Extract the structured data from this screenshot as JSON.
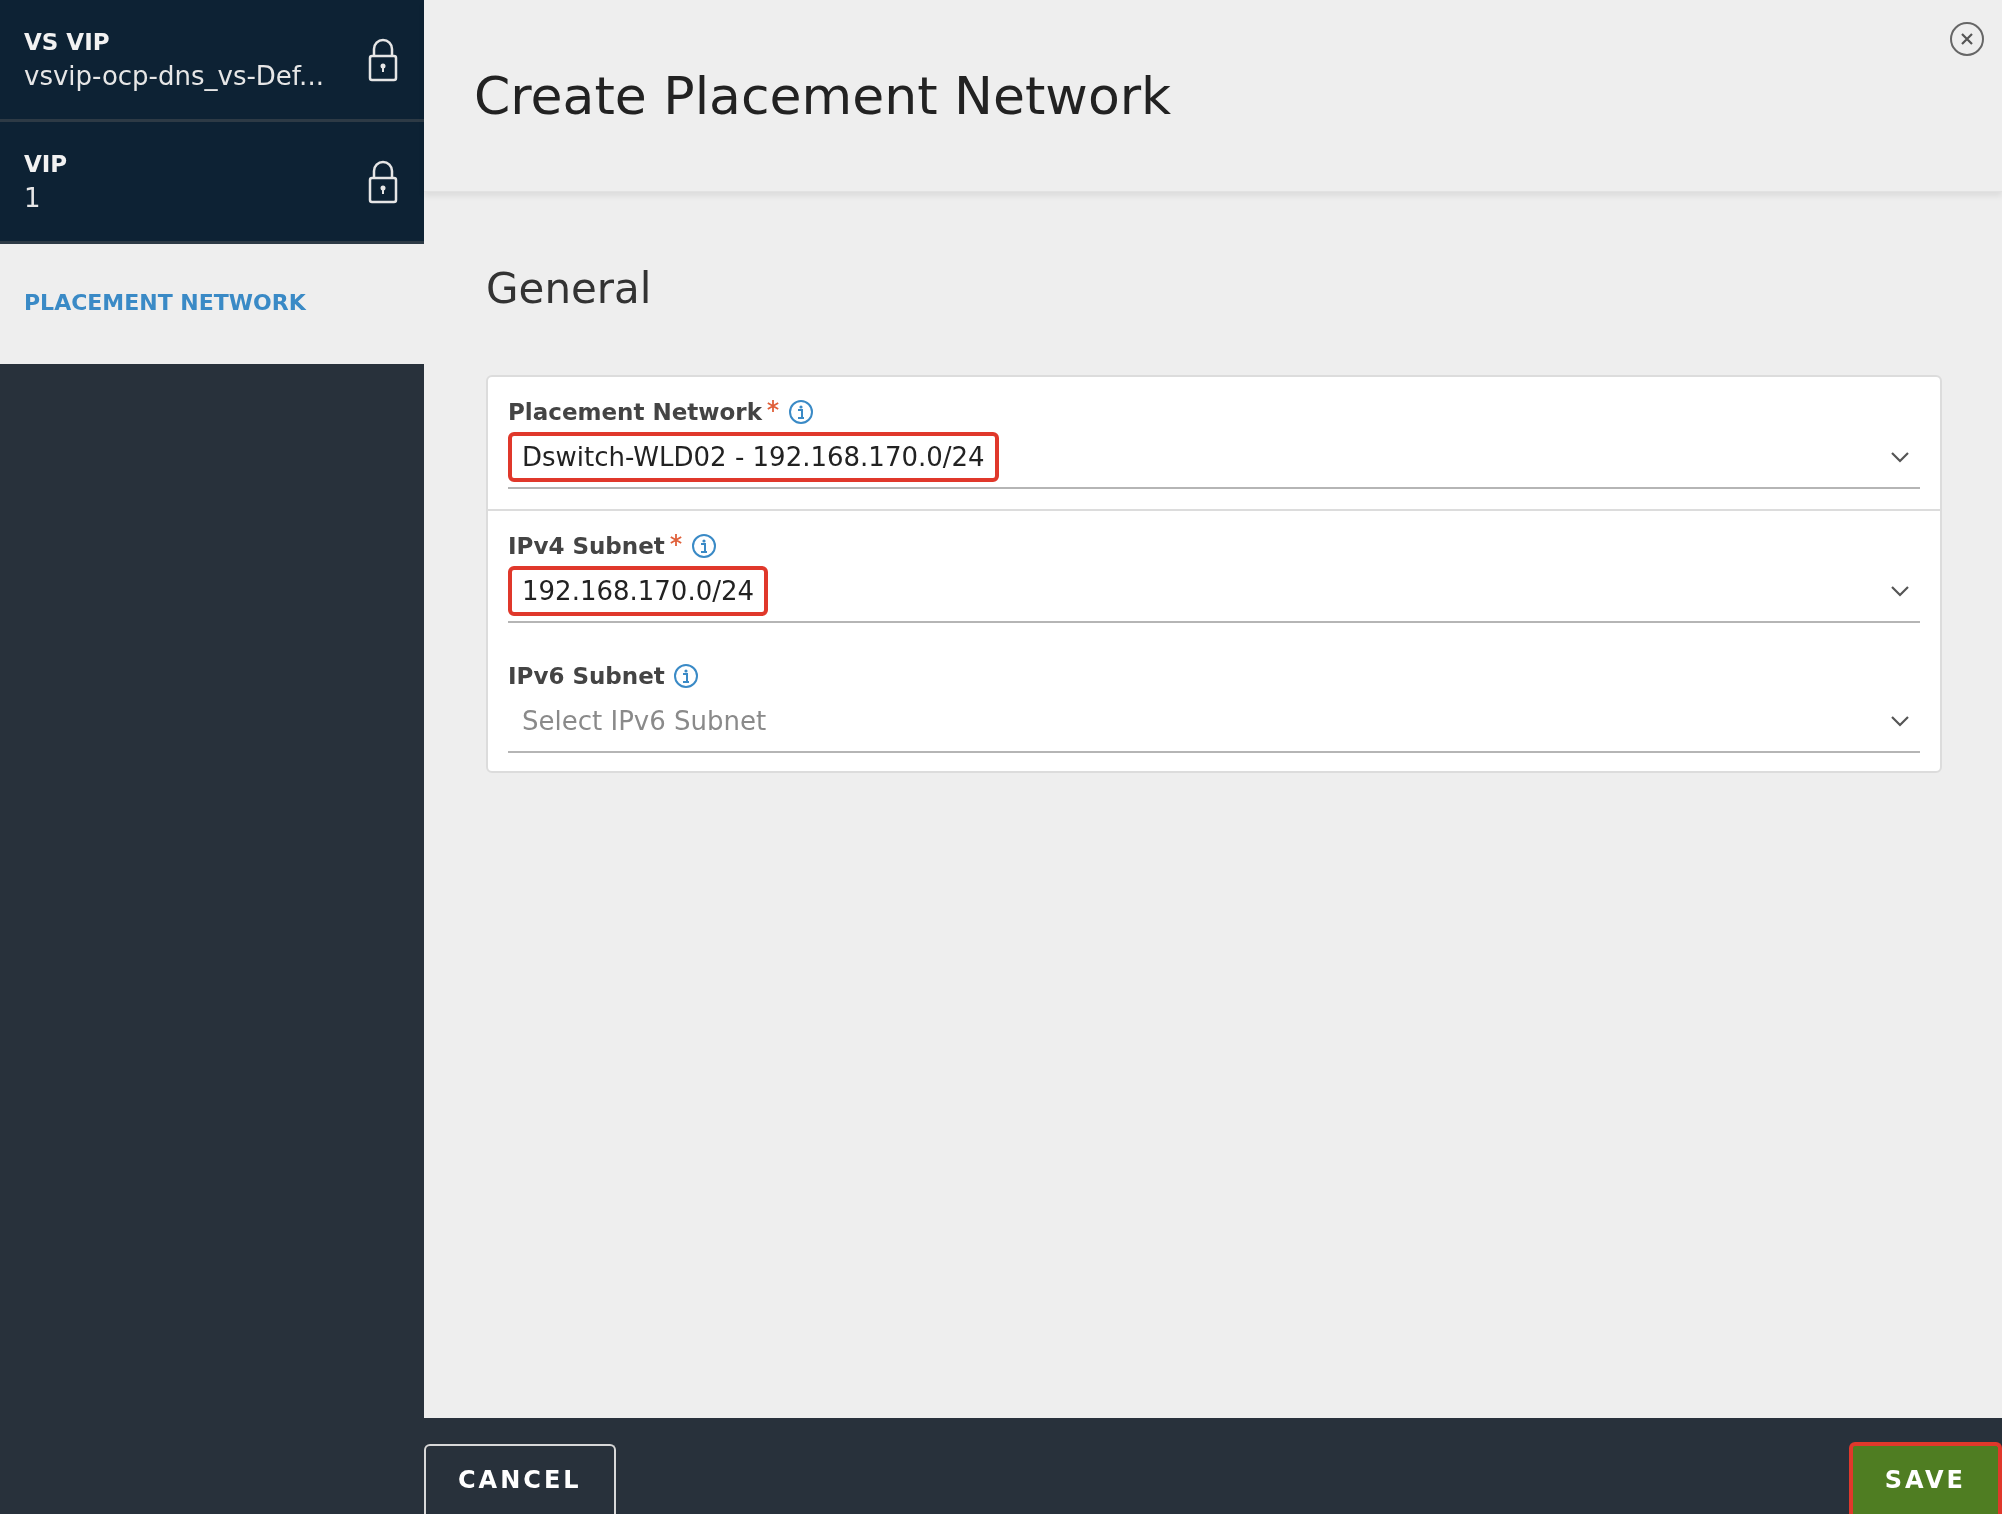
{
  "sidebar": {
    "items": [
      {
        "kind": "locked",
        "label": "VS VIP",
        "value": "vsvip-ocp-dns_vs-Def...",
        "selected": false
      },
      {
        "kind": "locked",
        "label": "VIP",
        "value": "1",
        "selected": false
      },
      {
        "kind": "link",
        "label": "PLACEMENT NETWORK",
        "selected": true
      }
    ]
  },
  "dialog": {
    "title": "Create Placement Network"
  },
  "section": {
    "title": "General"
  },
  "fields": [
    {
      "label": "Placement Network",
      "required": true,
      "value": "Dswitch-WLD02 - 192.168.170.0/24",
      "highlighted": true,
      "divider": true
    },
    {
      "label": "IPv4 Subnet",
      "required": true,
      "value": "192.168.170.0/24",
      "highlighted": true,
      "divider": false
    },
    {
      "label": "IPv6 Subnet",
      "required": false,
      "placeholder": "Select IPv6 Subnet",
      "highlighted": false,
      "divider": false
    }
  ],
  "footer": {
    "buttons": [
      {
        "kind": "secondary",
        "label": "CANCEL",
        "highlighted": false
      },
      {
        "kind": "primary",
        "label": "SAVE",
        "highlighted": true
      }
    ]
  }
}
